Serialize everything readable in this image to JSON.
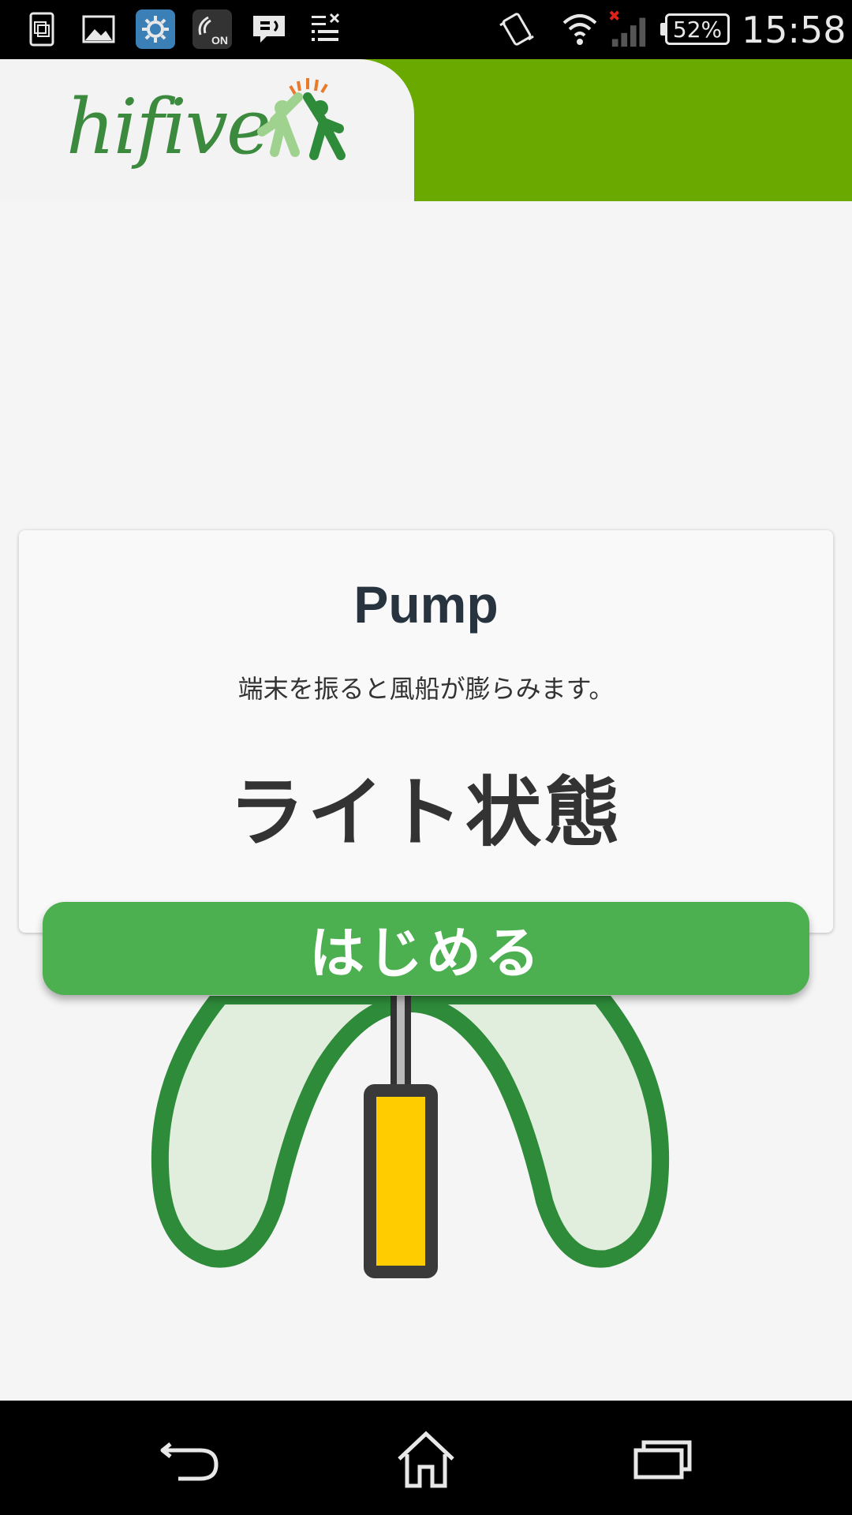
{
  "status_bar": {
    "icons": [
      "sim-card-icon",
      "image-icon",
      "settings-app-icon",
      "nfc-on-icon",
      "message-icon",
      "download-list-icon"
    ],
    "right_icons": [
      "vibrate-icon",
      "wifi-icon",
      "signal-no-sim-icon"
    ],
    "battery": "52%",
    "clock": "15:58"
  },
  "header": {
    "logo_text": "hifive",
    "accent_color": "#6aaa00",
    "logo_color": "#3b8a3e"
  },
  "card": {
    "title": "Pump",
    "description": "端末を振ると風船が膨らみます。",
    "state": "ライト状態"
  },
  "start_button": {
    "label": "はじめる",
    "color": "#4caf50"
  },
  "illustration": {
    "balloon_color": "#2e8b3a",
    "pump_handle_color": "#ffcc00"
  },
  "nav_bar": {
    "buttons": [
      "back-icon",
      "home-icon",
      "recent-apps-icon"
    ]
  }
}
